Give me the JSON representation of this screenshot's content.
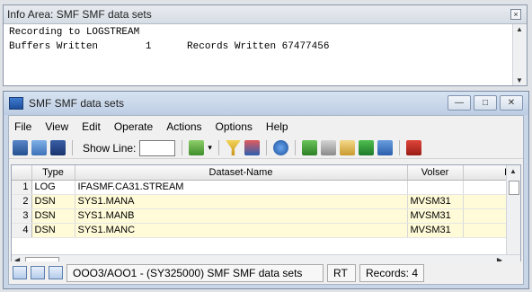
{
  "info": {
    "title": "Info Area: SMF SMF data sets",
    "close_glyph": "×",
    "line1": "Recording to LOGSTREAM",
    "line2": "Buffers Written        1      Records Written 67477456"
  },
  "window": {
    "title": "SMF SMF data sets",
    "min_glyph": "—",
    "max_glyph": "□",
    "close_glyph": "✕"
  },
  "menu": [
    "File",
    "View",
    "Edit",
    "Operate",
    "Actions",
    "Options",
    "Help"
  ],
  "toolbar": {
    "show_line_label": "Show Line:",
    "show_line_value": "",
    "dropdown_glyph": "▾"
  },
  "table": {
    "columns": [
      "",
      "Type",
      "Dataset-Name",
      "Volser",
      "E"
    ],
    "rows": [
      {
        "num": "1",
        "type": "LOG",
        "name": "IFASMF.CA31.STREAM",
        "volser": ""
      },
      {
        "num": "2",
        "type": "DSN",
        "name": "SYS1.MANA",
        "volser": "MVSM31"
      },
      {
        "num": "3",
        "type": "DSN",
        "name": "SYS1.MANB",
        "volser": "MVSM31"
      },
      {
        "num": "4",
        "type": "DSN",
        "name": "SYS1.MANC",
        "volser": "MVSM31"
      }
    ]
  },
  "scroll": {
    "up": "▲",
    "down": "▼",
    "left": "◀",
    "right": "▶"
  },
  "status": {
    "path": "OOO3/AOO1 - (SY325000) SMF SMF data sets",
    "mode": "RT",
    "records": "Records: 4"
  },
  "colors": {
    "highlight_row": "#fffbd8",
    "title_gradient": "#bccde3"
  }
}
